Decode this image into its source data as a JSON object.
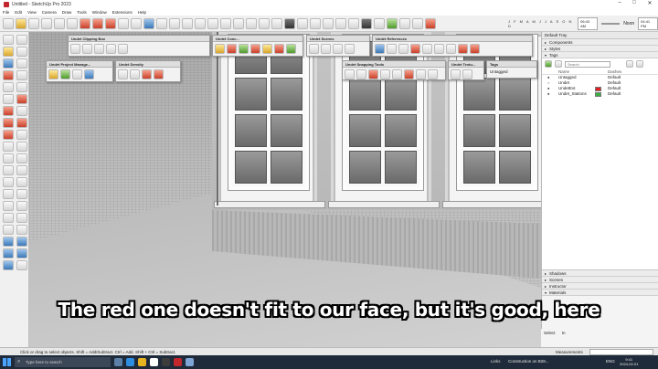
{
  "window": {
    "title": "Untitled - SketchUp Pro 2023"
  },
  "menu": [
    "File",
    "Edit",
    "View",
    "Camera",
    "Draw",
    "Tools",
    "Window",
    "Extensions",
    "Help"
  ],
  "shadows": {
    "months": "J F M A M J J A S O N D",
    "time1": "06:43 AM",
    "noon": "Noon",
    "time2": "04:41 PM"
  },
  "palettes": {
    "clipping": "Undet Clipping Box",
    "conceptual": "Undet Conc...",
    "scenes": "Undet Scenes",
    "references": "Undet References",
    "project": "Undet Project Manage...",
    "density": "Undet Density",
    "snapping": "Undet Snapping Tools",
    "textures": "Undet Textu...",
    "tags_mini_title": "Tags",
    "tags_mini_value": "Untagged"
  },
  "caption": "The red one doesn't fit to our face, but it's good, here",
  "tray": {
    "title": "Default Tray",
    "sections_top": [
      "Components",
      "Styles"
    ],
    "tags_section": "Tags",
    "search_placeholder": "Search",
    "col_name": "Name",
    "col_dashes": "Dashes",
    "rows": [
      {
        "name": "Untagged",
        "dash": "Default",
        "color": "",
        "eye": "●"
      },
      {
        "name": "Undet",
        "dash": "Default",
        "color": "",
        "eye": "○"
      },
      {
        "name": "UndetExt",
        "dash": "Default",
        "color": "#e02020",
        "eye": "●"
      },
      {
        "name": "Undet_Stations",
        "dash": "Default",
        "color": "#3cb043",
        "eye": "●"
      }
    ],
    "sections_bottom": [
      "Shadows",
      "Scenes",
      "Instructor",
      "Materials"
    ],
    "select_label": "Select",
    "in_label": "In"
  },
  "status": {
    "hint": "Click or drag to select objects. Shift = Add/Subtract. Ctrl = Add. Shift + Ctrl = Subtract.",
    "measurements": "Measurements"
  },
  "taskbar": {
    "search": "Type here to search",
    "links": "Links",
    "news": "Construction on B28...",
    "lang": "ENG",
    "time": "9:41",
    "date": "2024-02-01"
  },
  "colors": {
    "accent_red": "#e02020",
    "accent_green": "#3cb043",
    "taskbar": "#1f2b3a"
  }
}
